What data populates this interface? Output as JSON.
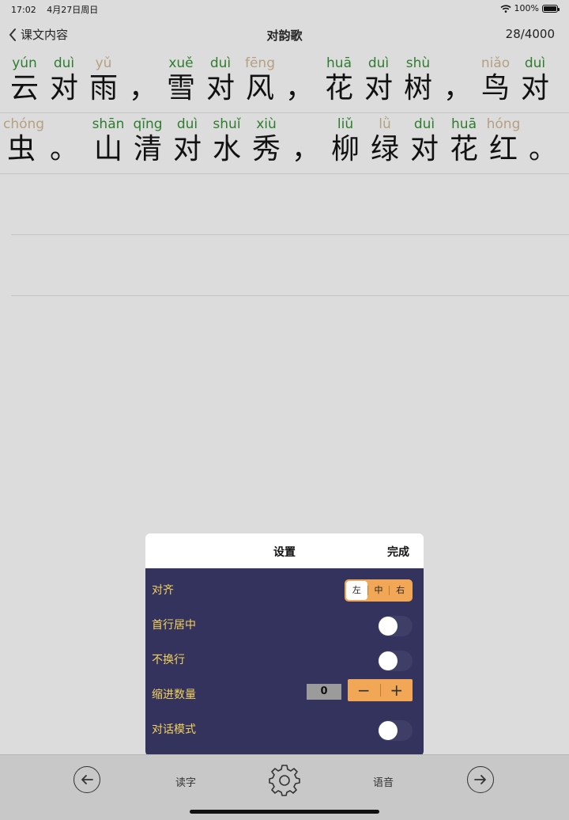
{
  "status": {
    "time": "17:02",
    "date": "4月27日周日",
    "battery": "100%"
  },
  "nav": {
    "back_label": "课文内容",
    "title": "对韵歌",
    "count": "28/4000"
  },
  "lines": [
    [
      {
        "py": "yún",
        "hz": "云",
        "c": "g"
      },
      {
        "py": "duì",
        "hz": "对",
        "c": "g"
      },
      {
        "py": "yǔ",
        "hz": "雨",
        "c": "y"
      },
      {
        "py": "",
        "hz": "，",
        "c": "g"
      },
      {
        "py": "xuě",
        "hz": "雪",
        "c": "g"
      },
      {
        "py": "duì",
        "hz": "对",
        "c": "g"
      },
      {
        "py": "fēng",
        "hz": "风",
        "c": "y"
      },
      {
        "py": "",
        "hz": "，",
        "c": "g"
      },
      {
        "py": "huā",
        "hz": "花",
        "c": "g"
      },
      {
        "py": "duì",
        "hz": "对",
        "c": "g"
      },
      {
        "py": "shù",
        "hz": "树",
        "c": "g"
      },
      {
        "py": "",
        "hz": "，",
        "c": "g"
      },
      {
        "py": "niǎo",
        "hz": "鸟",
        "c": "y"
      },
      {
        "py": "duì",
        "hz": "对",
        "c": "g"
      }
    ],
    [
      {
        "py": "chóng",
        "hz": "虫",
        "c": "y"
      },
      {
        "py": "",
        "hz": "。",
        "c": "g"
      },
      {
        "py": "shān",
        "hz": "山",
        "c": "g"
      },
      {
        "py": "qīng",
        "hz": "清",
        "c": "g"
      },
      {
        "py": "duì",
        "hz": "对",
        "c": "g"
      },
      {
        "py": "shuǐ",
        "hz": "水",
        "c": "g"
      },
      {
        "py": "xiù",
        "hz": "秀",
        "c": "g"
      },
      {
        "py": "",
        "hz": "，",
        "c": "g"
      },
      {
        "py": "liǔ",
        "hz": "柳",
        "c": "g"
      },
      {
        "py": "lǜ",
        "hz": "绿",
        "c": "y"
      },
      {
        "py": "duì",
        "hz": "对",
        "c": "g"
      },
      {
        "py": "huā",
        "hz": "花",
        "c": "g"
      },
      {
        "py": "hóng",
        "hz": "红",
        "c": "y"
      },
      {
        "py": "",
        "hz": "。",
        "c": "g"
      }
    ]
  ],
  "settings": {
    "title": "设置",
    "done": "完成",
    "align_label": "对齐",
    "align_options": [
      "左",
      "中",
      "右"
    ],
    "align_selected": "左",
    "first_line_center_label": "首行居中",
    "first_line_center_on": false,
    "no_wrap_label": "不换行",
    "no_wrap_on": false,
    "indent_label": "缩进数量",
    "indent_value": "0",
    "minus": "−",
    "plus": "+",
    "dialog_mode_label": "对话模式",
    "dialog_mode_on": false
  },
  "toolbar": {
    "read_char": "读字",
    "voice": "语音"
  }
}
